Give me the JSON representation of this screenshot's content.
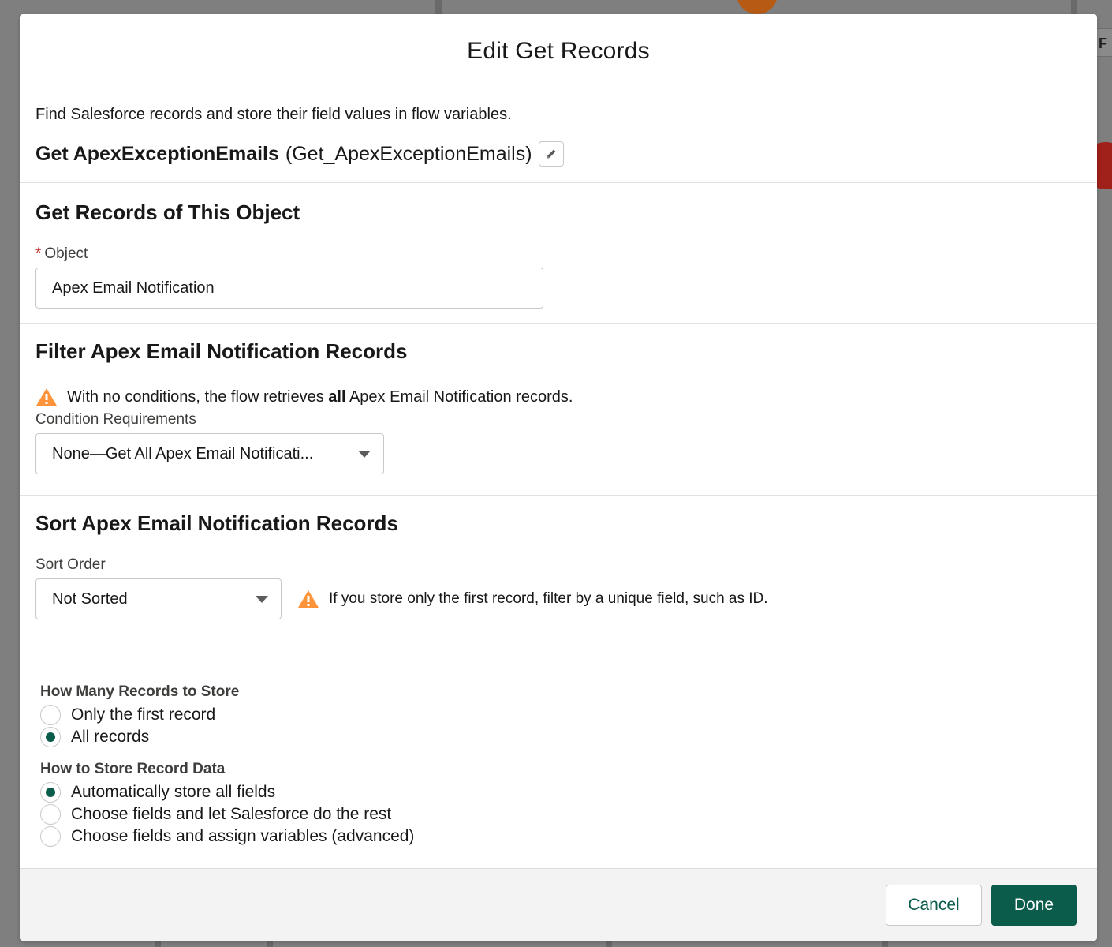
{
  "background": {
    "card_letter": "F"
  },
  "modal": {
    "title": "Edit Get Records",
    "description": "Find Salesforce records and store their field values in flow variables.",
    "element_label": "Get ApexExceptionEmails",
    "element_api_name": "(Get_ApexExceptionEmails)",
    "edit_icon": "pencil-icon"
  },
  "object_section": {
    "title": "Get Records of This Object",
    "required_marker": "*",
    "field_label": "Object",
    "value": "Apex Email Notification"
  },
  "filter_section": {
    "title": "Filter Apex Email Notification Records",
    "warning_prefix": "With no conditions, the flow retrieves",
    "warning_bold": "all",
    "warning_suffix": "Apex Email Notification records.",
    "condition_label": "Condition Requirements",
    "condition_value": "None—Get All Apex Email Notificati..."
  },
  "sort_section": {
    "title": "Sort Apex Email Notification Records",
    "sort_label": "Sort Order",
    "sort_value": "Not Sorted",
    "warning": "If you store only the first record, filter by a unique field, such as ID."
  },
  "store_section": {
    "how_many_label": "How Many Records to Store",
    "how_many_options": [
      {
        "label": "Only the first record",
        "checked": false
      },
      {
        "label": "All records",
        "checked": true
      }
    ],
    "how_store_label": "How to Store Record Data",
    "how_store_options": [
      {
        "label": "Automatically store all fields",
        "checked": true
      },
      {
        "label": "Choose fields and let Salesforce do the rest",
        "checked": false
      },
      {
        "label": "Choose fields and assign variables (advanced)",
        "checked": false
      }
    ]
  },
  "footer": {
    "cancel_label": "Cancel",
    "done_label": "Done"
  },
  "colors": {
    "brand": "#0b5c4b",
    "warning": "#fe9339",
    "required": "#c23934"
  }
}
